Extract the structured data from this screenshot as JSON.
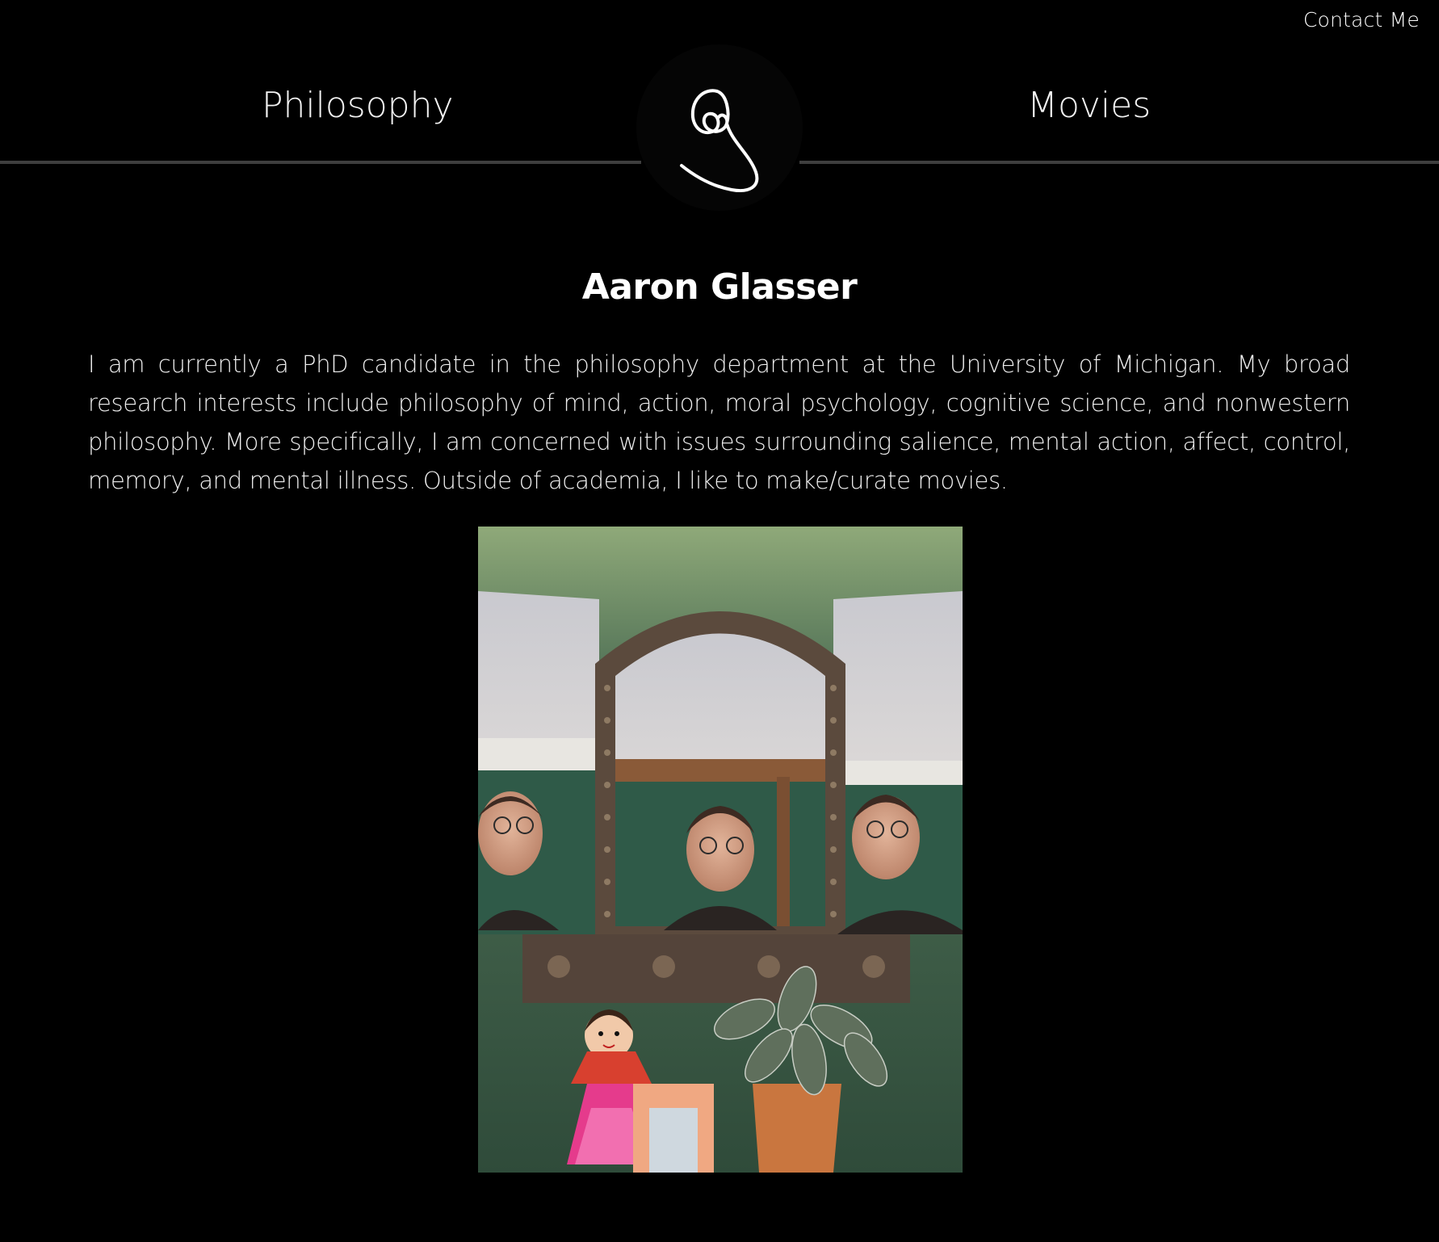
{
  "header": {
    "contact_label": "Contact Me",
    "nav": {
      "left_label": "Philosophy",
      "right_label": "Movies"
    },
    "logo_icon": "signature-logo-icon"
  },
  "main": {
    "title": "Aaron Glasser",
    "bio": "I am currently a PhD candidate in the philosophy department at the University of Michigan. My broad research interests include philosophy of mind, action, moral psychology, cognitive science, and nonwestern philosophy. More specifically, I am concerned with issues surrounding salience, mental action, affect, control, memory, and mental illness. Outside of academia, I like to make/curate movies.",
    "photo_icon": "portrait-photo"
  },
  "colors": {
    "background": "#000000",
    "text": "#f2f2f2",
    "rule": "#3e3e3e"
  }
}
